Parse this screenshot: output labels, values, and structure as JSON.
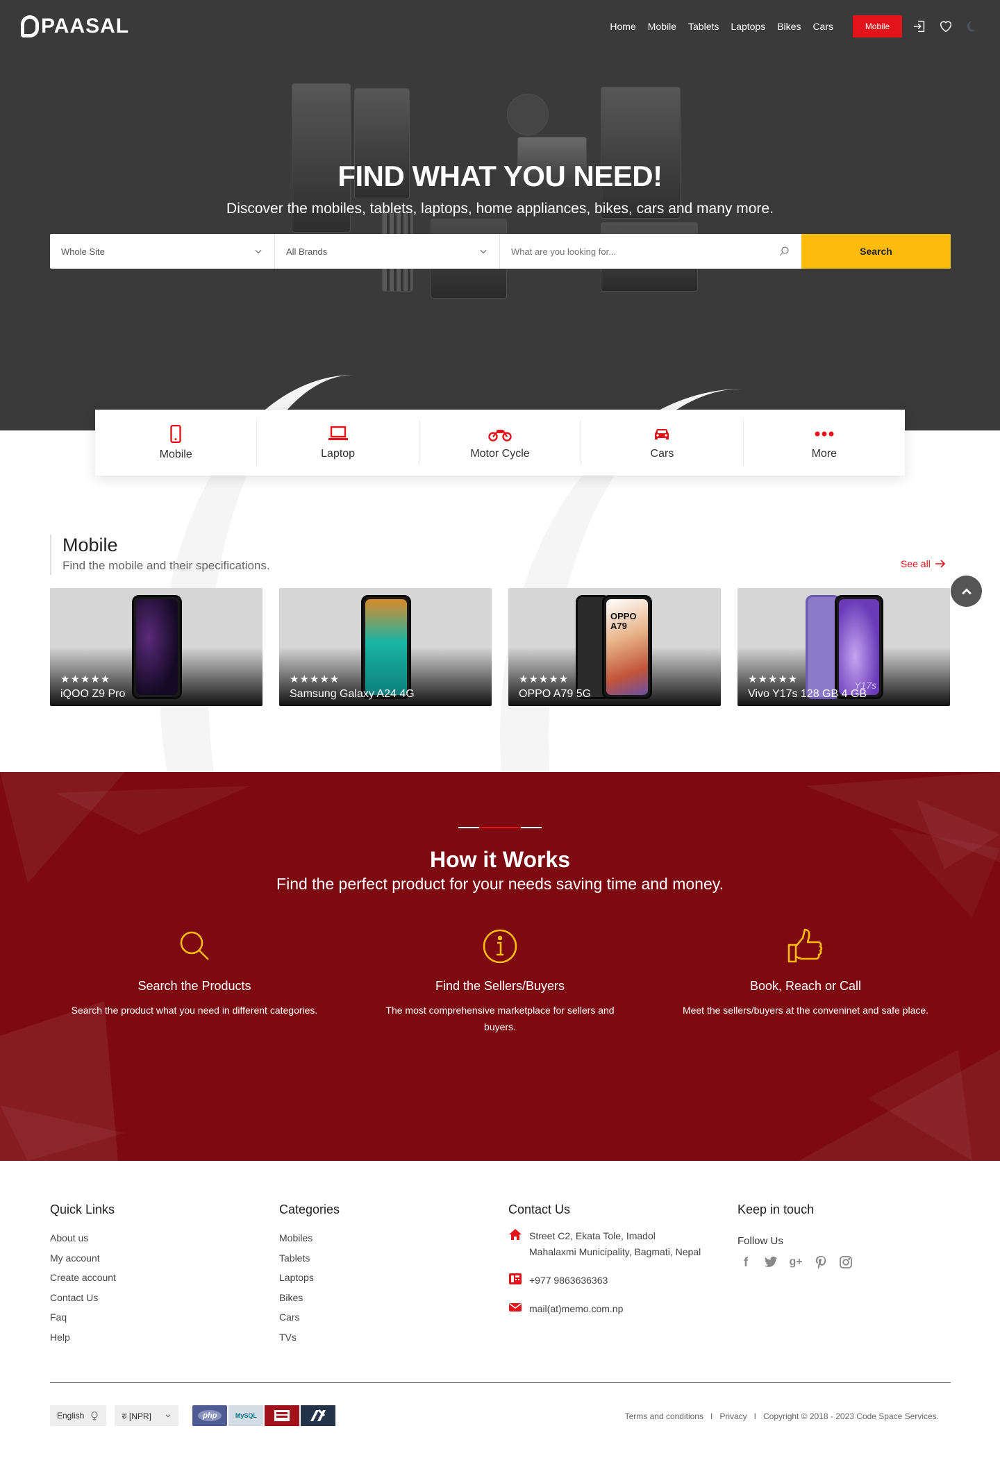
{
  "brand": {
    "name": "PAASAL"
  },
  "nav": {
    "items": [
      "Home",
      "Mobile",
      "Tablets",
      "Laptops",
      "Bikes",
      "Cars"
    ],
    "cta": "Mobile"
  },
  "hero": {
    "title": "FIND WHAT YOU NEED!",
    "subtitle": "Discover the mobiles, tablets, laptops, home appliances, bikes, cars and many more."
  },
  "search": {
    "scope": "Whole Site",
    "brand": "All Brands",
    "placeholder": "What are you looking for...",
    "button": "Search"
  },
  "categories": [
    {
      "label": "Mobile",
      "icon": "mobile-icon"
    },
    {
      "label": "Laptop",
      "icon": "laptop-icon"
    },
    {
      "label": "Motor Cycle",
      "icon": "motorcycle-icon"
    },
    {
      "label": "Cars",
      "icon": "car-icon"
    },
    {
      "label": "More",
      "icon": "more-dots-icon"
    }
  ],
  "mobile_section": {
    "title": "Mobile",
    "subtitle": "Find the mobile and their specifications.",
    "see_all": "See all",
    "products": [
      {
        "name": "iQOO Z9 Pro",
        "stars": "★★★★★",
        "rating": 5
      },
      {
        "name": "Samsung Galaxy A24 4G",
        "stars": "★★★★★",
        "rating": 5
      },
      {
        "name": "OPPO A79 5G",
        "stars": "★★★★★",
        "rating": 5,
        "screen_text": "OPPO A79"
      },
      {
        "name": "Vivo Y17s 128 GB 4 GB",
        "stars": "★★★★★",
        "rating": 5,
        "screen_text": "Y17s"
      }
    ]
  },
  "how": {
    "title": "How it Works",
    "subtitle": "Find the perfect product for your needs saving time and money.",
    "steps": [
      {
        "title": "Search the Products",
        "desc": "Search the product what you need in different categories.",
        "icon": "search-icon"
      },
      {
        "title": "Find the Sellers/Buyers",
        "desc": "The most comprehensive marketplace for sellers and buyers.",
        "icon": "info-icon"
      },
      {
        "title": "Book, Reach or Call",
        "desc": "Meet the sellers/buyers at the conveninet and safe place.",
        "icon": "thumbs-up-icon"
      }
    ]
  },
  "footer": {
    "quick_links": {
      "title": "Quick Links",
      "items": [
        "About us",
        "My account",
        "Create account",
        "Contact Us",
        "Faq",
        "Help"
      ]
    },
    "categories": {
      "title": "Categories",
      "items": [
        "Mobiles",
        "Tablets",
        "Laptops",
        "Bikes",
        "Cars",
        "TVs"
      ]
    },
    "contact": {
      "title": "Contact Us",
      "address_line1": "Street C2, Ekata Tole, Imadol",
      "address_line2": "Mahalaxmi Municipality, Bagmati, Nepal",
      "phone": "+977 9863636363",
      "email": "mail(at)memo.com.np"
    },
    "keep": {
      "title": "Keep in touch",
      "follow": "Follow Us"
    },
    "language": "English",
    "currency": "रु [NPR]",
    "tech": [
      "php",
      "MySQL"
    ],
    "terms": "Terms and conditions",
    "privacy": "Privacy",
    "copyright": "Copyright © 2018 - 2023 Code Space Services."
  },
  "colors": {
    "accent": "#e3131b",
    "search_button": "#fdbb0e",
    "how_bg": "#7d0a11",
    "hero_bg": "#3a3a3a",
    "icon_yellow": "#fdbb0e"
  }
}
